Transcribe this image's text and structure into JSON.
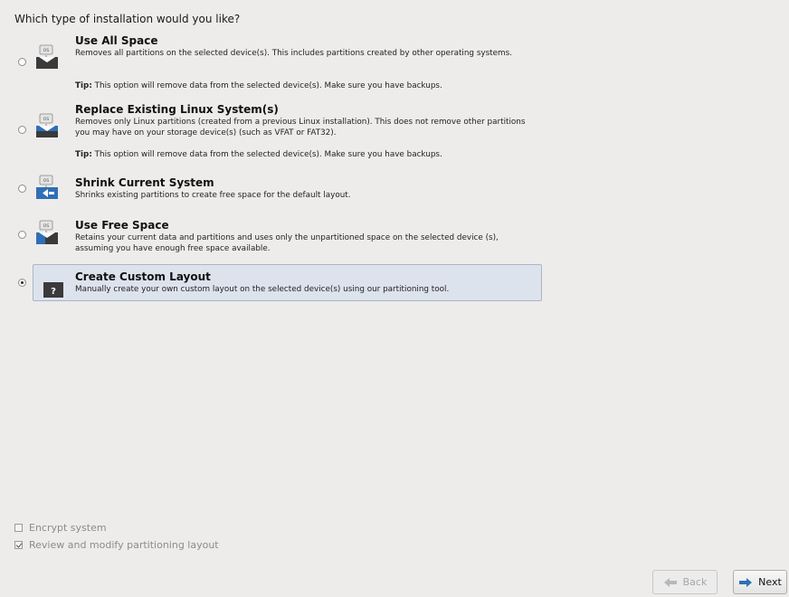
{
  "question": "Which type of installation would you like?",
  "options": [
    {
      "title": "Use All Space",
      "desc": "Removes all partitions on the selected device(s).  This includes partitions created by other operating systems.",
      "tip_label": "Tip:",
      "tip": "This option will remove data from the selected device(s).  Make sure you have backups.",
      "icon_badge": "OS"
    },
    {
      "title": "Replace Existing Linux System(s)",
      "desc": "Removes only Linux partitions (created from a previous Linux installation).  This does not remove other partitions you may have on your storage device(s) (such as VFAT or FAT32).",
      "tip_label": "Tip:",
      "tip": "This option will remove data from the selected device(s).  Make sure you have backups.",
      "icon_badge": "OS"
    },
    {
      "title": "Shrink Current System",
      "desc": "Shrinks existing partitions to create free space for the default layout.",
      "icon_badge": "OS"
    },
    {
      "title": "Use Free Space",
      "desc": "Retains your current data and partitions and uses only the unpartitioned space on the selected device (s), assuming you have enough free space available.",
      "icon_badge": "OS"
    },
    {
      "title": "Create Custom Layout",
      "desc": "Manually create your own custom layout on the selected device(s) using our partitioning tool.",
      "icon_badge": "?"
    }
  ],
  "selected_option": "Create Custom Layout",
  "checkboxes": {
    "encrypt_label": "Encrypt system",
    "encrypt_checked": false,
    "review_label": "Review and modify partitioning layout",
    "review_checked": true
  },
  "buttons": {
    "back_label": "Back",
    "next_label": "Next"
  },
  "colors": {
    "background": "#edeceb",
    "selected_bg": "#dde3ed",
    "icon_blue": "#2f6fb5"
  }
}
